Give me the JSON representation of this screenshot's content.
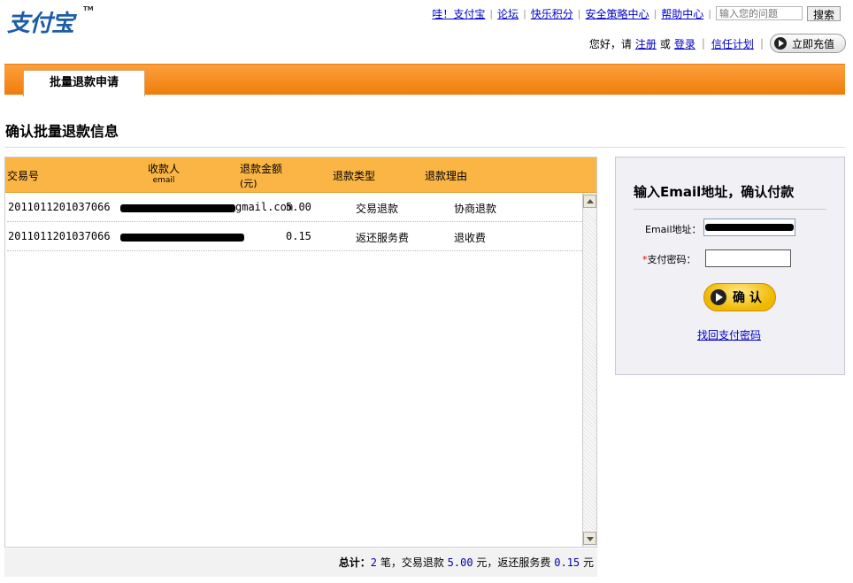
{
  "logo": {
    "text": "支付宝",
    "tm": "TM"
  },
  "topnav": {
    "links": [
      "哇！支付宝",
      "论坛",
      "快乐积分",
      "安全策略中心",
      "帮助中心"
    ],
    "search_placeholder": "输入您的问题",
    "search_button": "搜索"
  },
  "usernav": {
    "greeting": "您好，请",
    "register": "注册",
    "or": "或",
    "login": "登录",
    "trust_plan": "信任计划",
    "recharge": "立即充值"
  },
  "tabs": {
    "active": "批量退款申请"
  },
  "page_title": "确认批量退款信息",
  "table": {
    "headers": {
      "trade_no": "交易号",
      "payee": "收款人",
      "payee_sub": "email",
      "amount": "退款金额",
      "amount_sub": "(元)",
      "type": "退款类型",
      "reason": "退款理由"
    },
    "rows": [
      {
        "trade_no": "2011011201037066",
        "email": "gmail.com",
        "amount": "5.00",
        "type": "交易退款",
        "reason": "协商退款"
      },
      {
        "trade_no": "2011011201037066",
        "email": "",
        "amount": "0.15",
        "type": "返还服务费",
        "reason": "退收费"
      }
    ]
  },
  "summary": {
    "label": "总计：",
    "count": "2",
    "count_unit": "笔，交易退款",
    "trade_refund": "5.00",
    "mid": "元，返还服务费",
    "fee_refund": "0.15",
    "end": "元"
  },
  "confirm": {
    "title": "输入Email地址，确认付款",
    "email_label": "Email地址：",
    "password_label": "支付密码：",
    "required_mark": "*",
    "confirm_button": "确 认",
    "forgot_link": "找回支付密码"
  }
}
